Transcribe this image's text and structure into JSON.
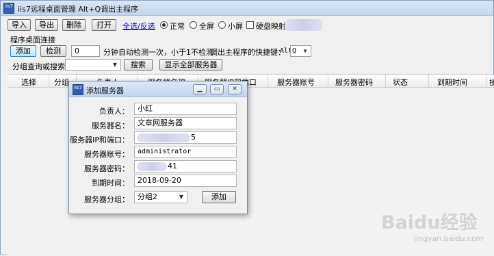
{
  "window": {
    "title": "iis7远程桌面管理 Alt+Q调出主程序",
    "icon_text": "iis7"
  },
  "toolbar": {
    "import_label": "导入",
    "export_label": "导出",
    "delete_label": "删除",
    "open_label": "打开",
    "select_all_link": "全选/反选",
    "mode_normal": "正常",
    "mode_fullscreen": "全屏",
    "mode_small": "小屏",
    "disk_mapping": "硬盘映射"
  },
  "connection": {
    "section_title": "程序桌面连接",
    "add_label": "添加",
    "check_label": "检测",
    "interval_value": "0",
    "interval_hint": "分钟自动检测一次，小于1不检测",
    "hotkey_label": "调出主程序的快捷键：",
    "hotkey_prefix": "Alt",
    "hotkey_value": "Q"
  },
  "search": {
    "label": "分组查询或搜索：",
    "query_value": "",
    "search_label": "搜索",
    "show_all_label": "显示全部服务器"
  },
  "table": {
    "columns": [
      "选择",
      "分组",
      "负责人",
      "服务器名称",
      "服务器IP和端口",
      "服务器账号",
      "服务器密码",
      "状态",
      "到期时间",
      "操作"
    ]
  },
  "dialog": {
    "title": "添加服务器",
    "fields": {
      "owner_label": "负责人：",
      "owner_value": "小红",
      "name_label": "服务器名：",
      "name_value": "文章网服务器",
      "ip_label": "服务器IP和端口：",
      "ip_value": "5",
      "account_label": "服务器账号：",
      "account_value": "administrator",
      "password_label": "服务器密码：",
      "password_value": "41",
      "expiry_label": "到期时间：",
      "expiry_value": "2018-09-20",
      "group_label": "服务器分组：",
      "group_value": "分组2"
    },
    "add_label": "添加"
  },
  "watermark": {
    "logo": "Baidu经验",
    "url": "jingyan.baidu.com"
  },
  "colors": {
    "link": "#0000ee",
    "accent": "#3c7fb1",
    "titlebar": "#c6d6ec"
  }
}
